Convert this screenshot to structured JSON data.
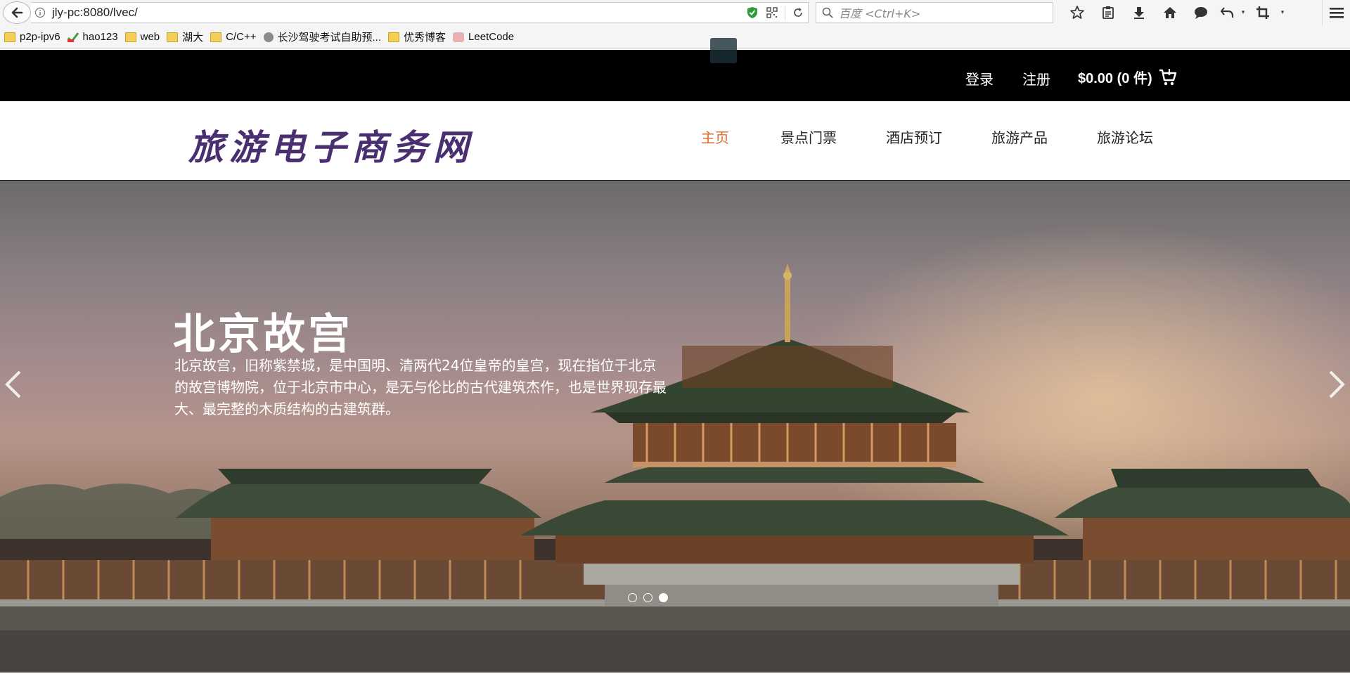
{
  "browser": {
    "url": "jly-pc:8080/lvec/",
    "search_placeholder": "百度 <Ctrl+K>",
    "bookmarks": [
      {
        "label": "p2p-ipv6",
        "icon": "folder-icon"
      },
      {
        "label": "hao123",
        "icon": "hao123-icon"
      },
      {
        "label": "web",
        "icon": "folder-icon"
      },
      {
        "label": "湖大",
        "icon": "folder-icon"
      },
      {
        "label": "C/C++",
        "icon": "folder-icon"
      },
      {
        "label": "长沙驾驶考试自助预...",
        "icon": "globe-icon"
      },
      {
        "label": "优秀博客",
        "icon": "folder-icon"
      },
      {
        "label": "LeetCode",
        "icon": "leetcode-icon"
      }
    ]
  },
  "topbar": {
    "login": "登录",
    "register": "注册",
    "cart": "$0.00 (0 件)"
  },
  "nav": {
    "logo": "旅游电子商务网",
    "items": [
      {
        "label": "主页",
        "active": true
      },
      {
        "label": "景点门票",
        "active": false
      },
      {
        "label": "酒店预订",
        "active": false
      },
      {
        "label": "旅游产品",
        "active": false
      },
      {
        "label": "旅游论坛",
        "active": false
      }
    ]
  },
  "hero": {
    "title": "北京故宫",
    "description": "北京故宫，旧称紫禁城，是中国明、清两代24位皇帝的皇宫，现在指位于北京的故宫博物院，位于北京市中心，是无与伦比的古代建筑杰作，也是世界现存最大、最完整的木质结构的古建筑群。",
    "slide_count": 3,
    "active_slide": 3
  }
}
